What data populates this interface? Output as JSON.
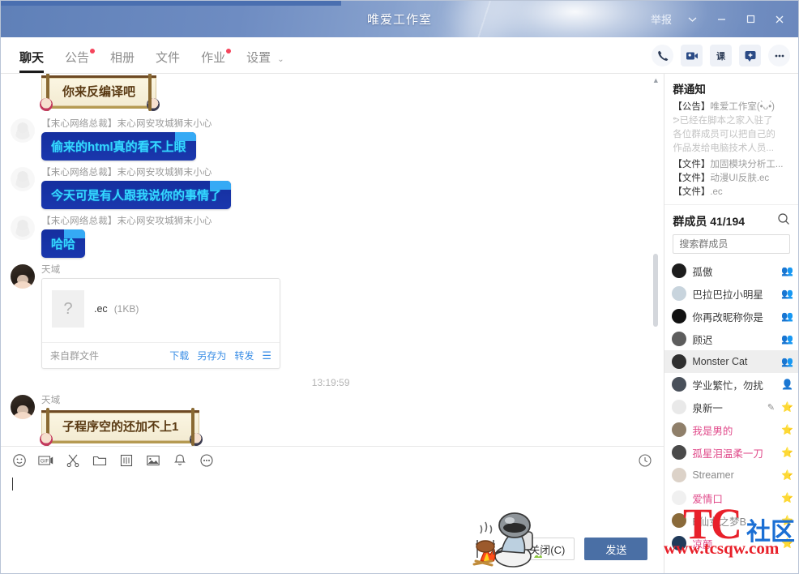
{
  "window": {
    "title": "唯爱工作室",
    "report_label": "举报",
    "chevron_icon": "chevron-down-icon",
    "minimize_icon": "minimize-icon",
    "maximize_icon": "maximize-icon",
    "close_icon": "close-icon"
  },
  "nav": {
    "tabs": [
      {
        "label": "聊天",
        "active": true,
        "dot": false
      },
      {
        "label": "公告",
        "active": false,
        "dot": true
      },
      {
        "label": "相册",
        "active": false,
        "dot": false
      },
      {
        "label": "文件",
        "active": false,
        "dot": false
      },
      {
        "label": "作业",
        "active": false,
        "dot": true
      },
      {
        "label": "设置",
        "active": false,
        "dot": false,
        "chevron": "⌄"
      }
    ],
    "icons": [
      {
        "name": "phone-call-icon",
        "glyph": "📞"
      },
      {
        "name": "video-call-icon",
        "glyph": "🎥"
      },
      {
        "name": "class-icon",
        "glyph": "课"
      },
      {
        "name": "add-app-icon",
        "glyph": "＋"
      },
      {
        "name": "more-icon",
        "glyph": "•••"
      }
    ]
  },
  "chat": {
    "messages": [
      {
        "sender": "",
        "type": "scroll",
        "text": "你来反编译吧"
      },
      {
        "sender": "【末心网络总裁】末心网安攻城狮末小心",
        "type": "blue",
        "text": "偷来的html真的看不上眼"
      },
      {
        "sender": "【末心网络总裁】末心网安攻城狮末小心",
        "type": "blue",
        "text": "今天可是有人跟我说你的事情了"
      },
      {
        "sender": "【末心网络总裁】末心网安攻城狮末小心",
        "type": "blue",
        "text": "哈哈"
      },
      {
        "sender": "天域",
        "type": "file",
        "file": {
          "name": ".ec",
          "size": "(1KB)",
          "source_label": "来自群文件",
          "actions": [
            "下载",
            "另存为",
            "转发"
          ],
          "menu_icon": "list-menu-icon",
          "thumb_icon": "unknown-file-icon"
        }
      },
      {
        "sender": "天域",
        "type": "scroll",
        "text": "子程序空的还加不上1"
      },
      {
        "sender": "天域",
        "type": "empty",
        "text": ""
      }
    ],
    "timestamp": "13:19:59"
  },
  "composer": {
    "toolbar_icons": [
      {
        "name": "emoji-icon",
        "glyph": "☺"
      },
      {
        "name": "gif-icon",
        "glyph": "GIF"
      },
      {
        "name": "screenshot-icon",
        "glyph": "✂"
      },
      {
        "name": "file-folder-icon",
        "glyph": "▭"
      },
      {
        "name": "code-snippet-icon",
        "glyph": "▤"
      },
      {
        "name": "image-icon",
        "glyph": "🖼"
      },
      {
        "name": "shake-bell-icon",
        "glyph": "🔔"
      },
      {
        "name": "more-tools-icon",
        "glyph": "⋯"
      }
    ],
    "history_icon": "chat-history-clock-icon",
    "input_value": "",
    "close_button": "关闭(C)",
    "send_button": "发送",
    "sticker": "pubg-campfire-sticker"
  },
  "sidebar": {
    "notice": {
      "title": "群通知",
      "lines": [
        {
          "tag": "【公告】",
          "text": "唯爱工作室(•̀ᴗ•́)"
        },
        {
          "tag": "",
          "text": "ᕗ已经在脚本之家入驻了"
        },
        {
          "tag": "",
          "text": "各位群成员可以把自己的"
        },
        {
          "tag": "",
          "text": "作品发给电脑技术人员..."
        },
        {
          "tag": "【文件】",
          "text": "加固模块分析工..."
        },
        {
          "tag": "【文件】",
          "text": "动漫UI反肤.ec"
        },
        {
          "tag": "【文件】",
          "text": ".ec"
        }
      ]
    },
    "members": {
      "title": "群成员",
      "count": "41/194",
      "search_icon": "search-icon",
      "search_placeholder": "搜索群成员",
      "list": [
        {
          "name": "孤傲",
          "badge": "👥",
          "style": "normal"
        },
        {
          "name": "巴拉巴拉小明星",
          "badge": "👥",
          "style": "normal"
        },
        {
          "name": "你再改昵称你是",
          "badge": "👥",
          "style": "normal"
        },
        {
          "name": "顾迟",
          "badge": "👥",
          "style": "normal"
        },
        {
          "name": "Monster Cat",
          "badge": "👥",
          "style": "selected"
        },
        {
          "name": "学业繁忙，勿扰",
          "badge": "👤",
          "style": "normal"
        },
        {
          "name": "泉新一",
          "badge": "⭐",
          "style": "normal",
          "pen": "✎"
        },
        {
          "name": "我是男的",
          "badge": "⭐",
          "style": "pink"
        },
        {
          "name": "孤星泪温柔一刀",
          "badge": "⭐",
          "style": "pink"
        },
        {
          "name": "Streamer",
          "badge": "⭐",
          "style": "dim"
        },
        {
          "name": "爱情口",
          "badge": "⭐",
          "style": "pink"
        },
        {
          "name": "B仙女之梦B",
          "badge": "⭐",
          "style": "dim"
        },
        {
          "name": "凉颜",
          "badge": "⭐",
          "style": "pink"
        }
      ]
    }
  },
  "watermark": {
    "tc": "TC",
    "community": "社区",
    "url": "www.tcsqw.com"
  }
}
